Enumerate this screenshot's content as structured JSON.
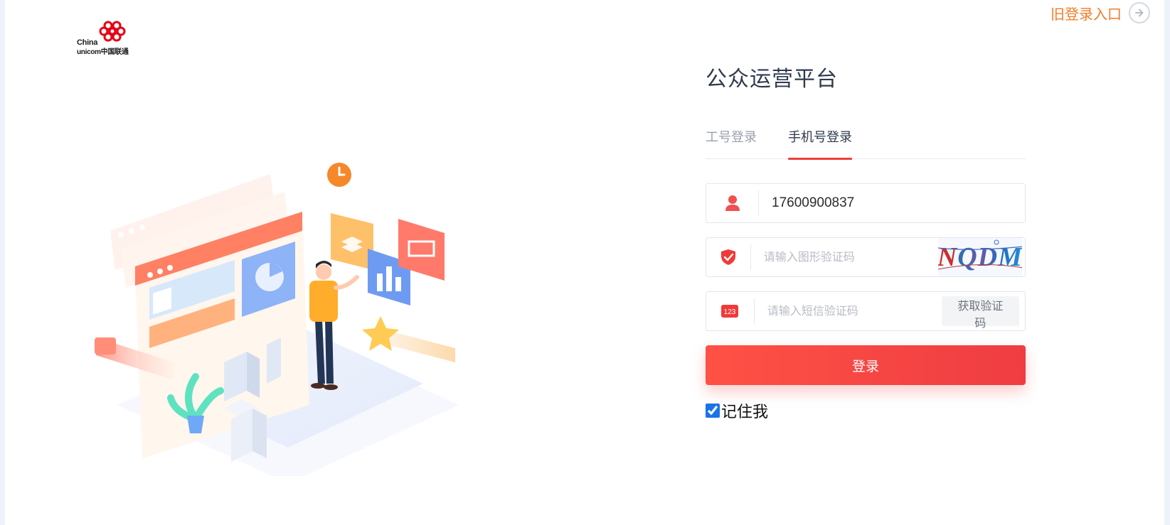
{
  "brand": {
    "line1": "China",
    "line2": "unicom中国联通"
  },
  "old_entry": {
    "label": "旧登录入口",
    "icon": "arrow-right-circle-icon"
  },
  "login": {
    "title": "公众运营平台",
    "tabs": [
      {
        "label": "工号登录",
        "active": false
      },
      {
        "label": "手机号登录",
        "active": true
      }
    ],
    "phone": {
      "value": "17600900837",
      "icon": "user-icon"
    },
    "captcha": {
      "placeholder": "请输入图形验证码",
      "icon": "shield-check-icon",
      "image_text": "NQDM"
    },
    "sms": {
      "placeholder": "请输入短信验证码",
      "icon": "sms-123-icon",
      "icon_text": "123",
      "button_label": "获取验证码"
    },
    "submit_label": "登录",
    "remember_label": "记住我",
    "remember_checked": true
  },
  "colors": {
    "accent_red": "#ee3e3a",
    "old_entry_orange": "#f47b27",
    "title": "#2f3a4c"
  }
}
